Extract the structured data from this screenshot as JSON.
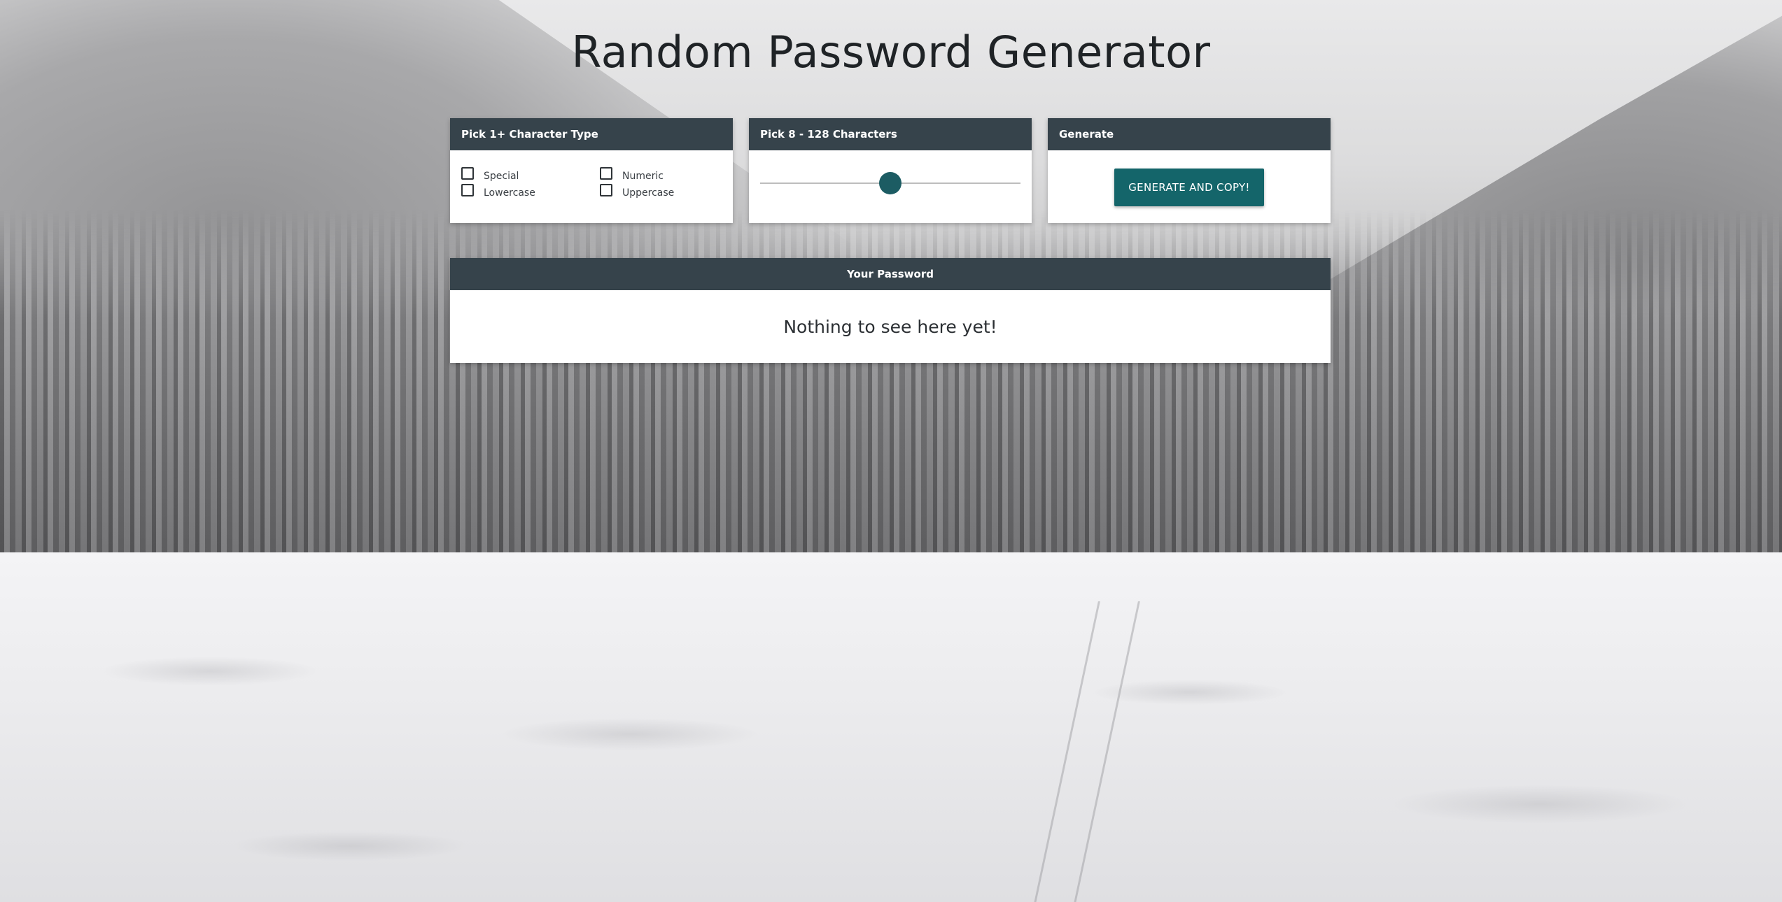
{
  "page": {
    "title": "Random Password Generator"
  },
  "character_types": {
    "header": "Pick 1+ Character Type",
    "options": [
      {
        "label": "Special",
        "checked": false
      },
      {
        "label": "Numeric",
        "checked": false
      },
      {
        "label": "Lowercase",
        "checked": false
      },
      {
        "label": "Uppercase",
        "checked": false
      }
    ]
  },
  "length": {
    "header": "Pick 8 - 128 Characters",
    "min": 8,
    "max": 128,
    "value": 68
  },
  "generate": {
    "header": "Generate",
    "button_label": "GENERATE AND COPY!"
  },
  "password": {
    "header": "Your Password",
    "text": "Nothing to see here yet!"
  },
  "colors": {
    "header_bg": "#36434b",
    "button_bg": "#14656a",
    "slider_thumb": "#1c5c63"
  }
}
